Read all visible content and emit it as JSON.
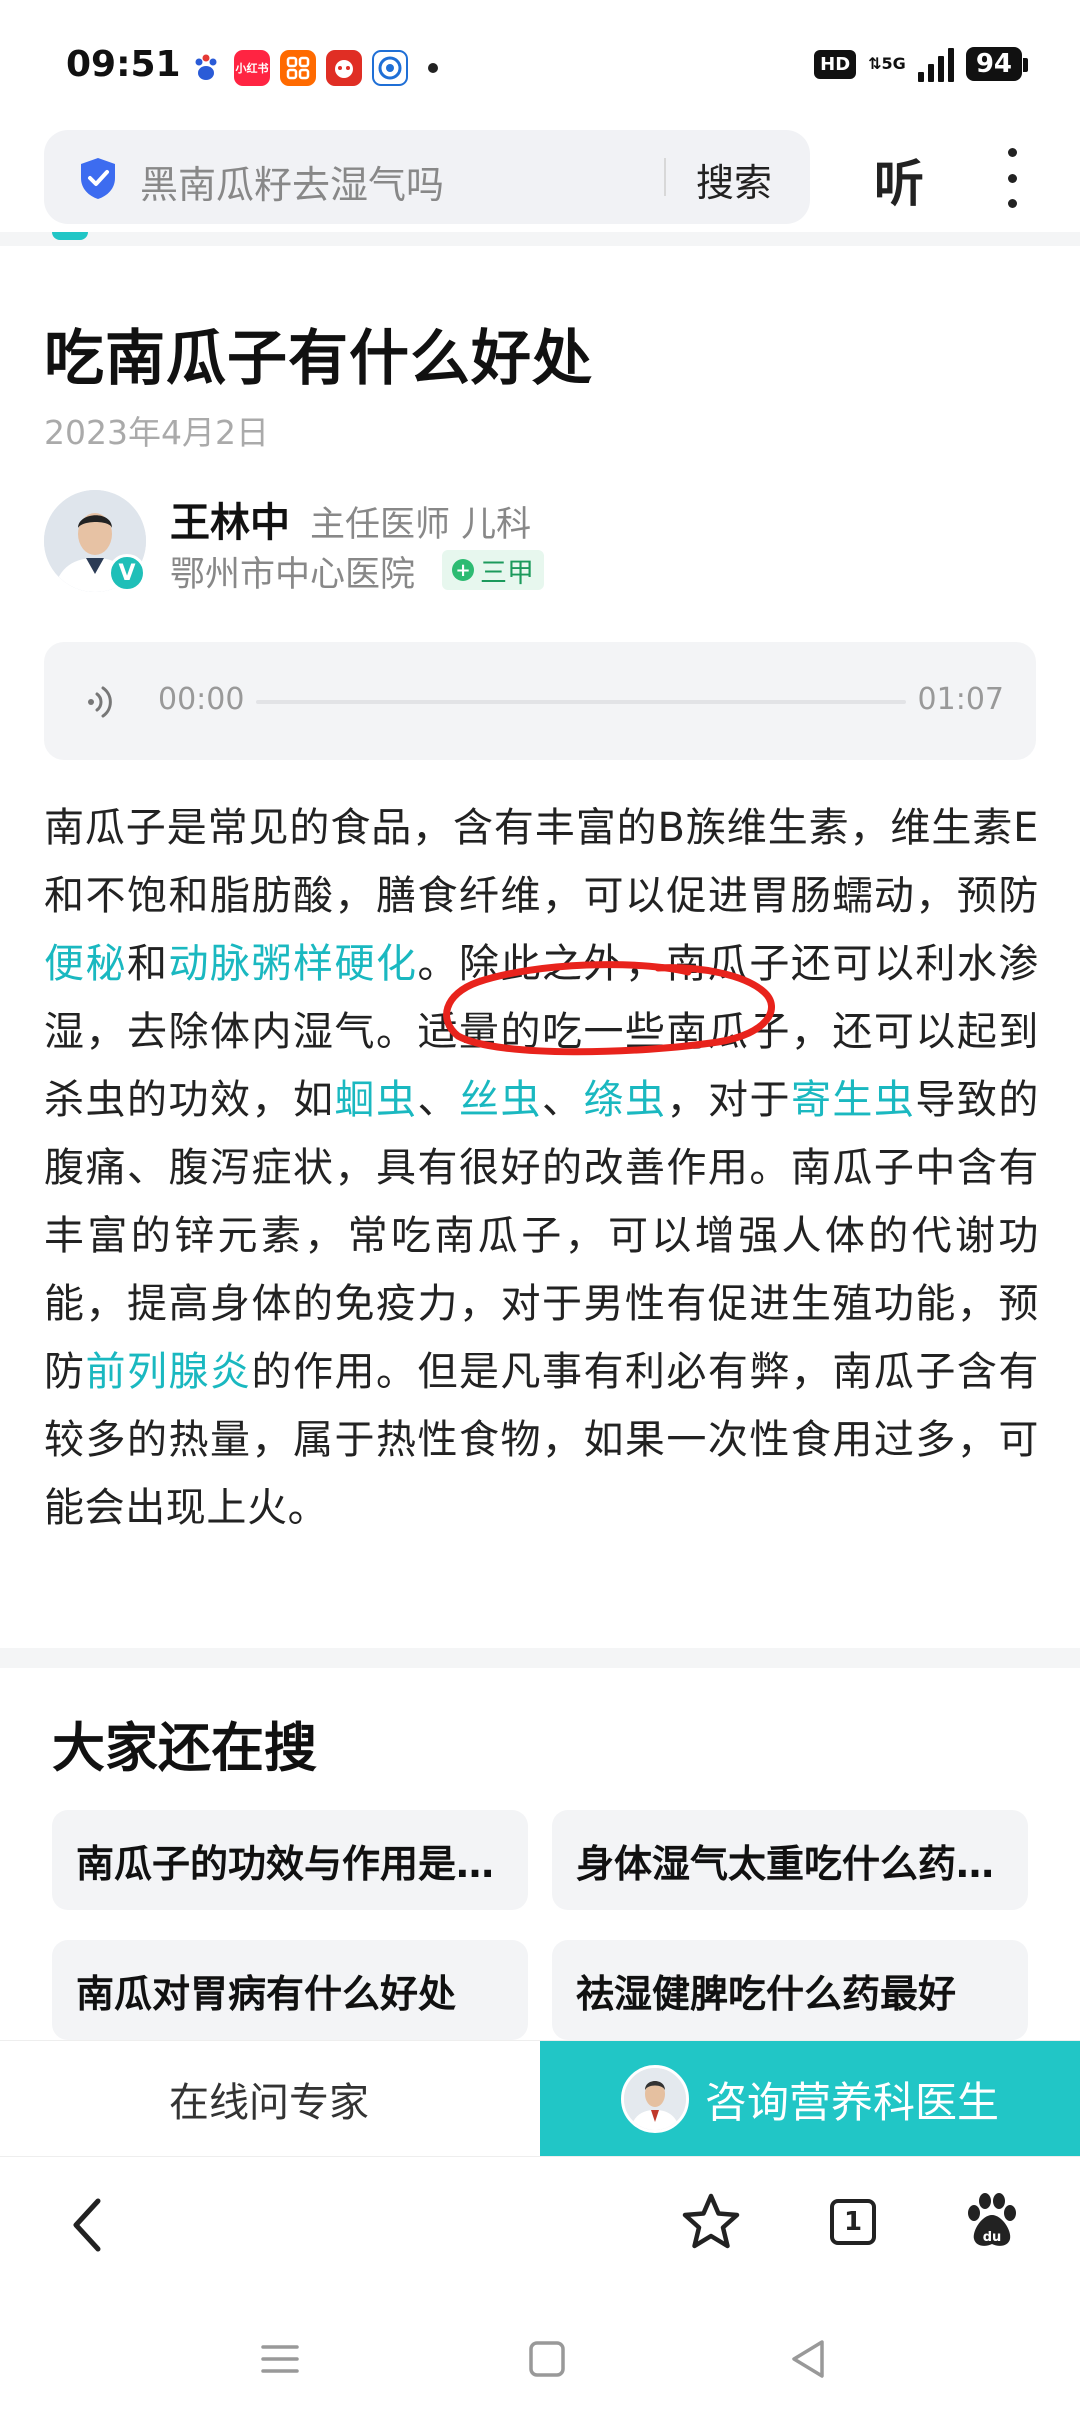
{
  "status_bar": {
    "time": "09:51",
    "app_icons": [
      {
        "name": "baidu-paw-icon",
        "label": "",
        "color": "#2a5bd7"
      },
      {
        "name": "xiaohongshu-icon",
        "label": "小红书",
        "color": "#ff2442"
      },
      {
        "name": "taobao-app-icon",
        "label": "",
        "color": "#ff6a00"
      },
      {
        "name": "pinduoduo-icon",
        "label": "",
        "color": "#e02e24"
      },
      {
        "name": "browser-app-icon",
        "label": "",
        "color": "#1f6fd6"
      }
    ],
    "hd": "HD",
    "network": "5G",
    "battery": "94"
  },
  "header": {
    "search_text": "黑南瓜籽去湿气吗",
    "search_button": "搜索",
    "listen_button": "听",
    "more_icon": "more-vertical-icon",
    "shield_icon": "shield-check-icon"
  },
  "article": {
    "title": "吃南瓜子有什么好处",
    "date": "2023年4月2日",
    "doctor": {
      "name": "王林中",
      "title": "主任医师 儿科",
      "hospital": "鄂州市中心医院",
      "level": "三甲",
      "verify_mark": "V"
    },
    "audio": {
      "current": "00:00",
      "total": "01:07",
      "progress": 0
    },
    "body": {
      "t1": "南瓜子是常见的食品，含有丰富的B族维生素，维生素E和不饱和脂肪酸，膳食纤维，可以促进胃肠蠕动，预防",
      "l1": "便秘",
      "t2": "和",
      "l2": "动脉粥样硬化",
      "t3": "。除此之外，南瓜子还可以利水渗湿，去除体内湿气。适量的吃一些南瓜子，还可以起到杀虫的功效，如",
      "l3": "蛔虫",
      "t4": "、",
      "l4": "丝虫",
      "t5": "、",
      "l5": "绦虫",
      "t6": "，对于",
      "l6": "寄生虫",
      "t7": "导致的腹痛、腹泻症状，具有很好的改善作用。南瓜子中含有丰富的锌元素，常吃南瓜子，可以增强人体的代谢功能，提高身体的免疫力，对于男性有促进生殖功能，预防",
      "l7": "前列腺炎",
      "t8": "的作用。但是凡事有利必有弊，南瓜子含有较多的热量，属于热性食物，如果一次性食用过多，可能会出现上火。"
    },
    "link_color": "#1ab8c0"
  },
  "related": {
    "title": "大家还在搜",
    "items": [
      "南瓜子的功效与作用是什么",
      "身体湿气太重吃什么药最好",
      "南瓜对胃病有什么好处",
      "祛湿健脾吃什么药最好"
    ]
  },
  "consult": {
    "ask_expert": "在线问专家",
    "consult_button": "咨询营养科医生",
    "accent": "#21c6c6"
  },
  "browser_nav": {
    "tab_count": "1",
    "icons": [
      "back-arrow-icon",
      "star-icon",
      "tabs-icon",
      "baidu-du-icon"
    ]
  },
  "system_nav": {
    "icons": [
      "menu-icon",
      "home-square-icon",
      "back-triangle-icon"
    ]
  },
  "annotation": {
    "color": "#e8231c"
  }
}
